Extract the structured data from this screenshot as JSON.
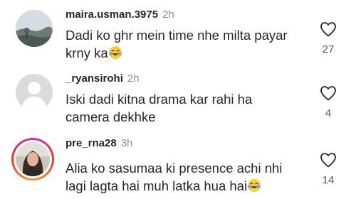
{
  "comments": [
    {
      "username": "maira.usman.3975",
      "time": "2h",
      "text_line1": "Dadi ko ghr mein time nhe milta payar",
      "text_line2": "krny ka",
      "emoji": "laughing-tears",
      "likes": "27",
      "avatar": "landscape-photo"
    },
    {
      "username": "_ryansirohi",
      "time": "2h",
      "text_line1": "Iski dadi kitna drama kar rahi ha",
      "text_line2": "camera dekhke",
      "likes": "4",
      "avatar": "default-person"
    },
    {
      "username": "pre_rna28",
      "time": "3h",
      "text_line1": "Alia ko sasumaa ki presence achi nhi",
      "text_line2": "lagi lagta hai muh latka hua hai",
      "emoji": "laughing-tears",
      "likes": "14",
      "avatar": "portrait-photo",
      "has_story": true
    }
  ],
  "colors": {
    "text": "#262626",
    "muted": "#8e8e8e",
    "story_ring": "#f0372a"
  }
}
